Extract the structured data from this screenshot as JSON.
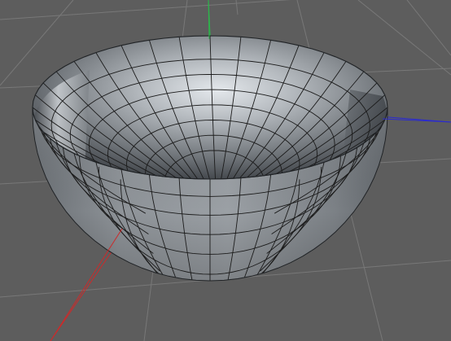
{
  "viewport": {
    "name": "3d-perspective-viewport",
    "background_color": "#5d5d5d",
    "grid_color": "#787878",
    "axis_colors": {
      "x": "#cc2a2a",
      "y": "#2bb84a",
      "z": "#2a2ad0"
    },
    "object": {
      "type": "hemisphere-bowl",
      "shading": "gouraud-gray",
      "wireframe_color": "#1b1b1b",
      "outer_color": "#8c9196",
      "inner_highlight_color": "#e2e6ea",
      "inner_shadow_color": "#3d4146"
    }
  }
}
